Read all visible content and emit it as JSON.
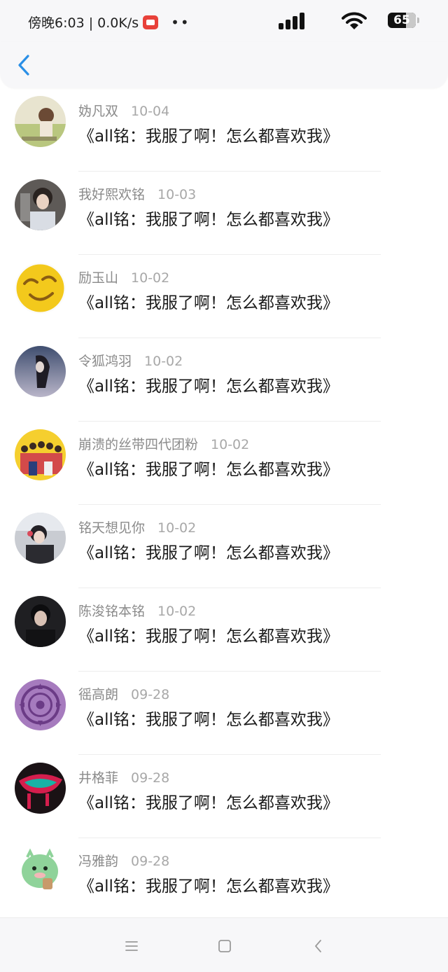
{
  "status_bar": {
    "time_net": "傍晚6:03 | 0.0K/s",
    "dots": "••",
    "battery": "65"
  },
  "nav": {
    "back_icon": "chevron-left-icon"
  },
  "comments": [
    {
      "user": "妫凡双",
      "date": "10-04",
      "text": "《all铭：我服了啊！怎么都喜欢我》"
    },
    {
      "user": "我好熙欢铭",
      "date": "10-03",
      "text": "《all铭：我服了啊！怎么都喜欢我》"
    },
    {
      "user": "励玉山",
      "date": "10-02",
      "text": "《all铭：我服了啊！怎么都喜欢我》"
    },
    {
      "user": "令狐鸿羽",
      "date": "10-02",
      "text": "《all铭：我服了啊！怎么都喜欢我》"
    },
    {
      "user": "崩溃的丝带四代团粉",
      "date": "10-02",
      "text": "《all铭：我服了啊！怎么都喜欢我》"
    },
    {
      "user": "铭天想见你",
      "date": "10-02",
      "text": "《all铭：我服了啊！怎么都喜欢我》"
    },
    {
      "user": "陈浚铭本铭",
      "date": "10-02",
      "text": "《all铭：我服了啊！怎么都喜欢我》"
    },
    {
      "user": "徭高朗",
      "date": "09-28",
      "text": "《all铭：我服了啊！怎么都喜欢我》"
    },
    {
      "user": "井格菲",
      "date": "09-28",
      "text": "《all铭：我服了啊！怎么都喜欢我》"
    },
    {
      "user": "冯雅韵",
      "date": "09-28",
      "text": "《all铭：我服了啊！怎么都喜欢我》"
    }
  ],
  "colors": {
    "accent": "#2a8fe6",
    "username": "#8a8a8a",
    "date": "#a8a8a8"
  }
}
